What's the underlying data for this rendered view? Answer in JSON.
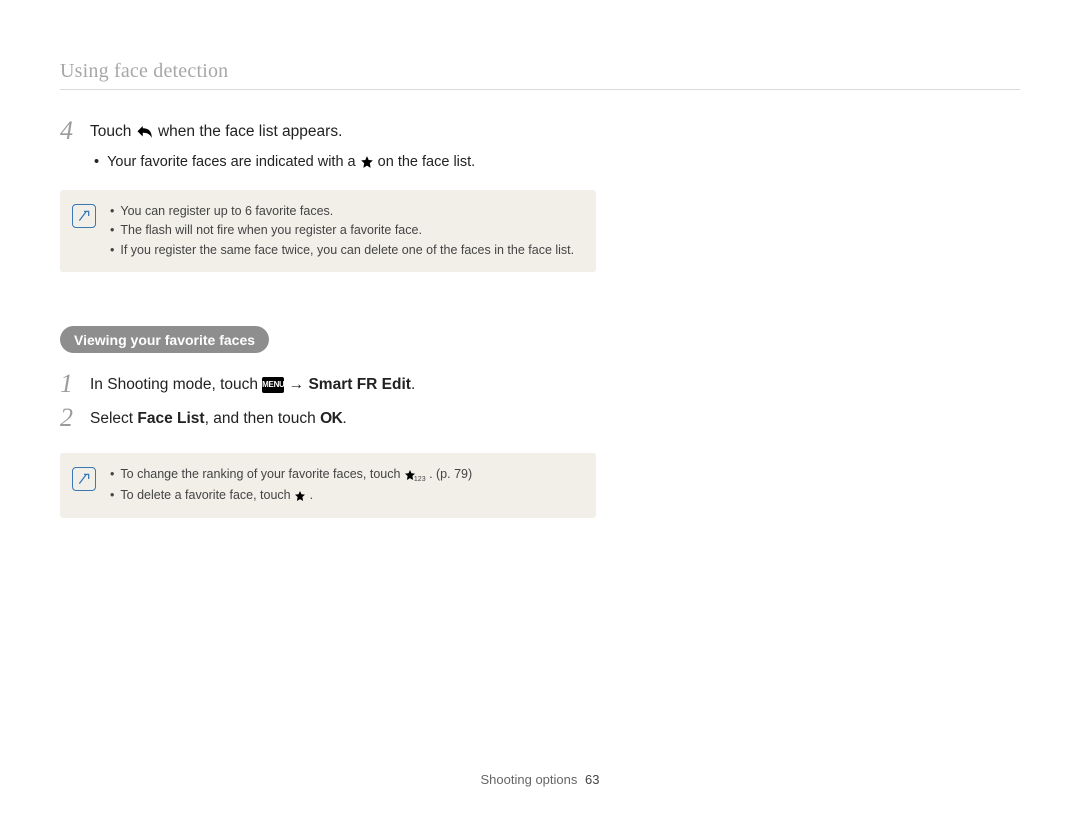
{
  "header": {
    "title": "Using face detection"
  },
  "step4": {
    "number": "4",
    "pre": "Touch ",
    "post": " when the face list appears.",
    "bullet_pre": "Your favorite faces are indicated with a ",
    "bullet_post": " on the face list."
  },
  "note1": {
    "items": [
      "You can register up to 6 favorite faces.",
      "The flash will not fire when you register a favorite face.",
      "If you register the same face twice, you can delete one of the faces in the face list."
    ]
  },
  "pill": "Viewing your favorite faces",
  "step1": {
    "number": "1",
    "pre": "In Shooting mode, touch ",
    "arrow": " → ",
    "bold": "Smart FR Edit",
    "post": "."
  },
  "step2": {
    "number": "2",
    "pre": "Select ",
    "bold": "Face List",
    "mid": ", and then touch ",
    "ok": "OK",
    "post": "."
  },
  "note2": {
    "items": {
      "a_pre": "To change the ranking of your favorite faces, touch ",
      "a_post": ". (p. 79)",
      "a_sub": "123",
      "b_pre": "To delete a favorite face, touch ",
      "b_post": "."
    }
  },
  "footer": {
    "label": "Shooting options",
    "page": "63"
  },
  "icons": {
    "menu_label": "MENU"
  }
}
